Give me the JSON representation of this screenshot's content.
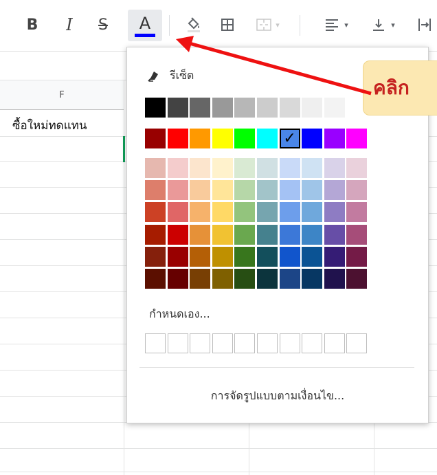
{
  "toolbar": {
    "bold_label": "B",
    "italic_label": "I",
    "strike_label": "S",
    "text_color_label": "A",
    "text_color_current": "#0000ff",
    "dropdown_glyph": "▾"
  },
  "sheet": {
    "column_header": "F",
    "cell_text": "ซื้อใหม่ทดแทน"
  },
  "color_picker": {
    "reset_label": "รีเซ็ต",
    "custom_label": "กำหนดเอง...",
    "conditional_link": "การจัดรูปแบบตามเงื่อนไข...",
    "selected_color": "#4a86e8",
    "check_glyph": "✓",
    "grays": [
      "#000000",
      "#434343",
      "#666666",
      "#999999",
      "#b7b7b7",
      "#cccccc",
      "#d9d9d9",
      "#efefef",
      "#f3f3f3",
      "#ffffff"
    ],
    "vivid": [
      "#980000",
      "#ff0000",
      "#ff9900",
      "#ffff00",
      "#00ff00",
      "#00ffff",
      "#4a86e8",
      "#0000ff",
      "#9900ff",
      "#ff00ff"
    ],
    "palette": [
      [
        "#e6b8af",
        "#f4cccc",
        "#fce5cd",
        "#fff2cc",
        "#d9ead3",
        "#d0e0e3",
        "#c9daf8",
        "#cfe2f3",
        "#d9d2e9",
        "#ead1dc"
      ],
      [
        "#dd7e6b",
        "#ea9999",
        "#f9cb9c",
        "#ffe599",
        "#b6d7a8",
        "#a2c4c9",
        "#a4c2f4",
        "#9fc5e8",
        "#b4a7d6",
        "#d5a6bd"
      ],
      [
        "#cc4125",
        "#e06666",
        "#f6b26b",
        "#ffd966",
        "#93c47d",
        "#76a5af",
        "#6d9eeb",
        "#6fa8dc",
        "#8e7cc3",
        "#c27ba0"
      ],
      [
        "#a61c00",
        "#cc0000",
        "#e69138",
        "#f1c232",
        "#6aa84f",
        "#45818e",
        "#3c78d8",
        "#3d85c6",
        "#674ea7",
        "#a64d79"
      ],
      [
        "#85200c",
        "#990000",
        "#b45f06",
        "#bf9000",
        "#38761d",
        "#134f5c",
        "#1155cc",
        "#0b5394",
        "#351c75",
        "#741b47"
      ],
      [
        "#5b0f00",
        "#660000",
        "#783f04",
        "#7f6000",
        "#274e13",
        "#0c343d",
        "#1c4587",
        "#073763",
        "#20124d",
        "#4c1130"
      ]
    ],
    "custom_slots": 10
  },
  "callout": {
    "text": "คลิก"
  }
}
